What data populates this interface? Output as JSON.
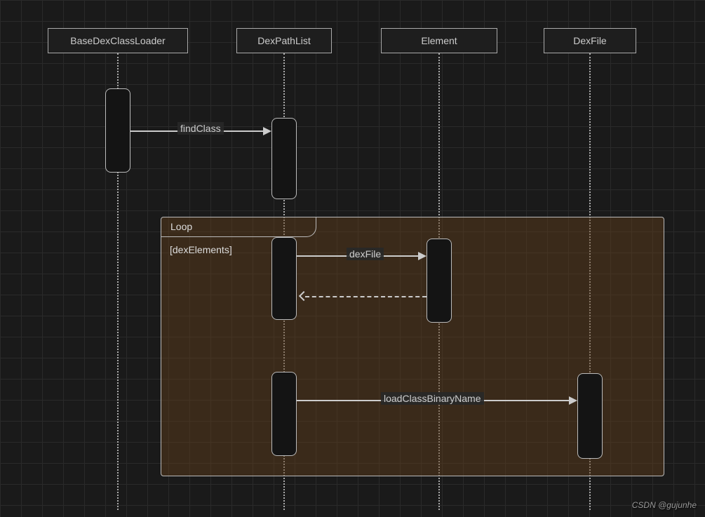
{
  "participants": {
    "p1": "BaseDexClassLoader",
    "p2": "DexPathList",
    "p3": "Element",
    "p4": "DexFile"
  },
  "messages": {
    "m1": "findClass",
    "m2": "dexFile",
    "m3": "loadClassBinaryName"
  },
  "loop": {
    "title": "Loop",
    "condition": "[dexElements]"
  },
  "watermark": "CSDN @gujunhe"
}
